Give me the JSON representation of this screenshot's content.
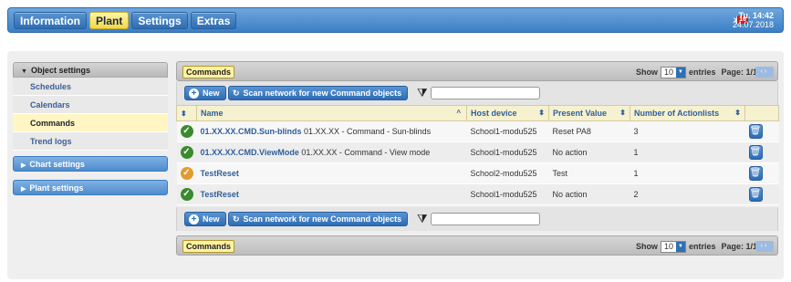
{
  "header": {
    "nav": [
      "Information",
      "Plant",
      "Settings",
      "Extras"
    ],
    "active_nav": "Plant",
    "notification_count": "16",
    "time": "Tu. 14:42",
    "date": "24.07.2018"
  },
  "sidebar": {
    "section_title": "Object settings",
    "items": [
      "Schedules",
      "Calendars",
      "Commands",
      "Trend logs"
    ],
    "selected": "Commands",
    "collapsed_sections": [
      "Chart settings",
      "Plant settings"
    ]
  },
  "panel": {
    "tag": "Commands",
    "show_label": "Show",
    "entries_value": "10",
    "entries_label": "entries",
    "page_label": "Page: 1/1",
    "new_label": "New",
    "scan_label": "Scan network for new Command objects",
    "filter_placeholder": "",
    "columns": [
      "Name",
      "Host device",
      "Present Value",
      "Number of Actionlists"
    ],
    "rows": [
      {
        "status": "ok",
        "name": "01.XX.XX.CMD.Sun-blinds",
        "desc": "01.XX.XX - Command - Sun-blinds",
        "host": "School1-modu525",
        "value": "Reset PA8",
        "count": "3"
      },
      {
        "status": "ok",
        "name": "01.XX.XX.CMD.ViewMode",
        "desc": "01.XX.XX - Command - View mode",
        "host": "School1-modu525",
        "value": "No action",
        "count": "1"
      },
      {
        "status": "warn",
        "name": "TestReset",
        "desc": "",
        "host": "School2-modu525",
        "value": "Test",
        "count": "1"
      },
      {
        "status": "ok",
        "name": "TestReset",
        "desc": "",
        "host": "School1-modu525",
        "value": "No action",
        "count": "2"
      }
    ]
  },
  "colors": {
    "accent": "#3b7fc6",
    "highlight": "#fff3a2",
    "ok": "#3a8a2e",
    "warn": "#e39a2e"
  }
}
